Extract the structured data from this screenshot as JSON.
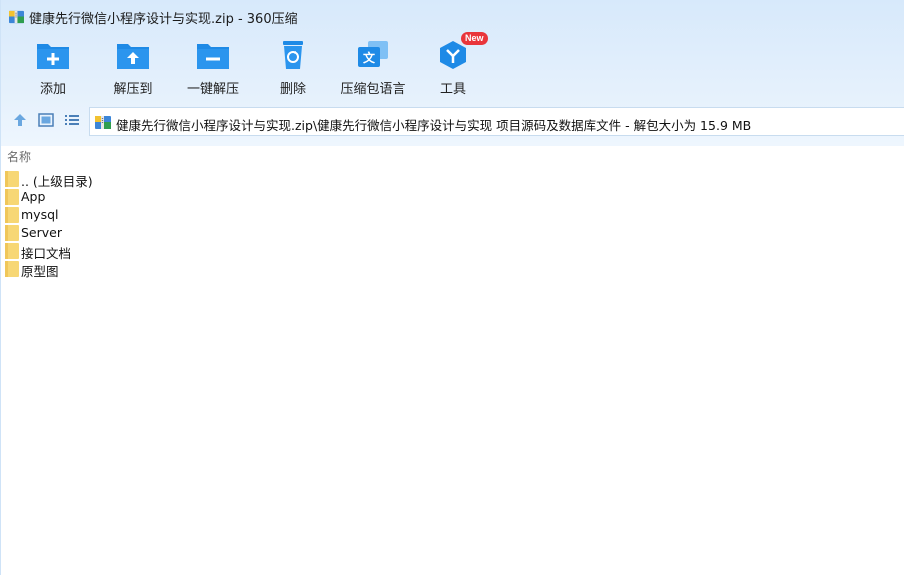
{
  "window": {
    "title": "健康先行微信小程序设计与实现.zip - 360压缩"
  },
  "toolbar": {
    "items": [
      {
        "label": "添加",
        "icon": "add-folder-icon"
      },
      {
        "label": "解压到",
        "icon": "extract-to-icon"
      },
      {
        "label": "一键解压",
        "icon": "one-click-extract-icon"
      },
      {
        "label": "删除",
        "icon": "trash-icon"
      },
      {
        "label": "压缩包语言",
        "icon": "language-icon"
      },
      {
        "label": "工具",
        "icon": "tools-icon",
        "badge": "New"
      }
    ]
  },
  "nav": {
    "up_icon": "up-arrow-icon",
    "view_icon": "thumbnail-view-icon",
    "list_icon": "list-view-icon",
    "path": "健康先行微信小程序设计与实现.zip\\健康先行微信小程序设计与实现 项目源码及数据库文件 - 解包大小为 15.9 MB"
  },
  "columns": {
    "name": "名称"
  },
  "files": [
    {
      "name": ".. (上级目录)"
    },
    {
      "name": "App"
    },
    {
      "name": "mysql"
    },
    {
      "name": "Server"
    },
    {
      "name": "接口文档"
    },
    {
      "name": "原型图"
    }
  ],
  "colors": {
    "accent": "#1e8ae6",
    "folder": "#f7d775",
    "badge": "#e9353b"
  }
}
